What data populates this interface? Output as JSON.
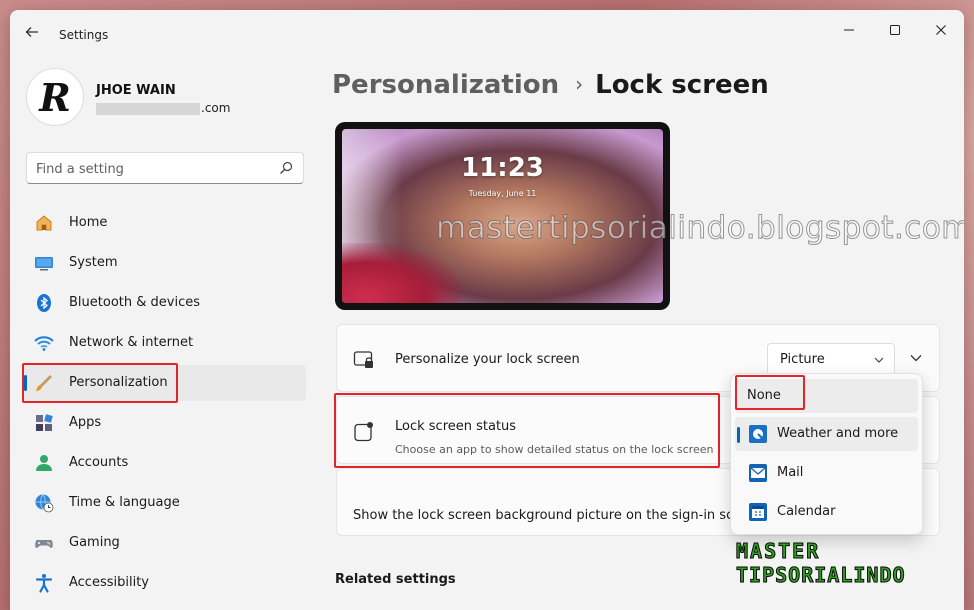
{
  "window": {
    "title": "Settings"
  },
  "profile": {
    "name": "JHOE WAIN",
    "email_suffix": ".com",
    "avatar_letter": "R"
  },
  "search": {
    "placeholder": "Find a setting"
  },
  "sidebar": {
    "items": [
      {
        "label": "Home",
        "icon": "home-icon"
      },
      {
        "label": "System",
        "icon": "monitor-icon"
      },
      {
        "label": "Bluetooth & devices",
        "icon": "bluetooth-icon"
      },
      {
        "label": "Network & internet",
        "icon": "wifi-icon"
      },
      {
        "label": "Personalization",
        "icon": "brush-icon",
        "active": true
      },
      {
        "label": "Apps",
        "icon": "apps-icon"
      },
      {
        "label": "Accounts",
        "icon": "person-icon"
      },
      {
        "label": "Time & language",
        "icon": "globe-clock-icon"
      },
      {
        "label": "Gaming",
        "icon": "gamepad-icon"
      },
      {
        "label": "Accessibility",
        "icon": "accessibility-icon"
      }
    ]
  },
  "breadcrumb": {
    "parent": "Personalization",
    "separator": "›",
    "current": "Lock screen"
  },
  "preview": {
    "time": "11:23",
    "date": "Tuesday, June 11"
  },
  "cards": {
    "personalize": {
      "title": "Personalize your lock screen",
      "value": "Picture"
    },
    "status": {
      "title": "Lock screen status",
      "subtitle": "Choose an app to show detailed status on the lock screen"
    },
    "signin": {
      "title": "Show the lock screen background picture on the sign-in scree"
    }
  },
  "dropdown": {
    "options": [
      {
        "label": "None"
      },
      {
        "label": "Weather and more",
        "selected": true
      },
      {
        "label": "Mail"
      },
      {
        "label": "Calendar"
      }
    ]
  },
  "related": {
    "title": "Related settings"
  },
  "overlay": {
    "watermark": "mastertipsorialindo.blogspot.com",
    "logo_line1": "MASTER",
    "logo_line2": "TIPSORIALINDO"
  },
  "colors": {
    "accent": "#0067c0",
    "highlight": "#e0252b"
  }
}
